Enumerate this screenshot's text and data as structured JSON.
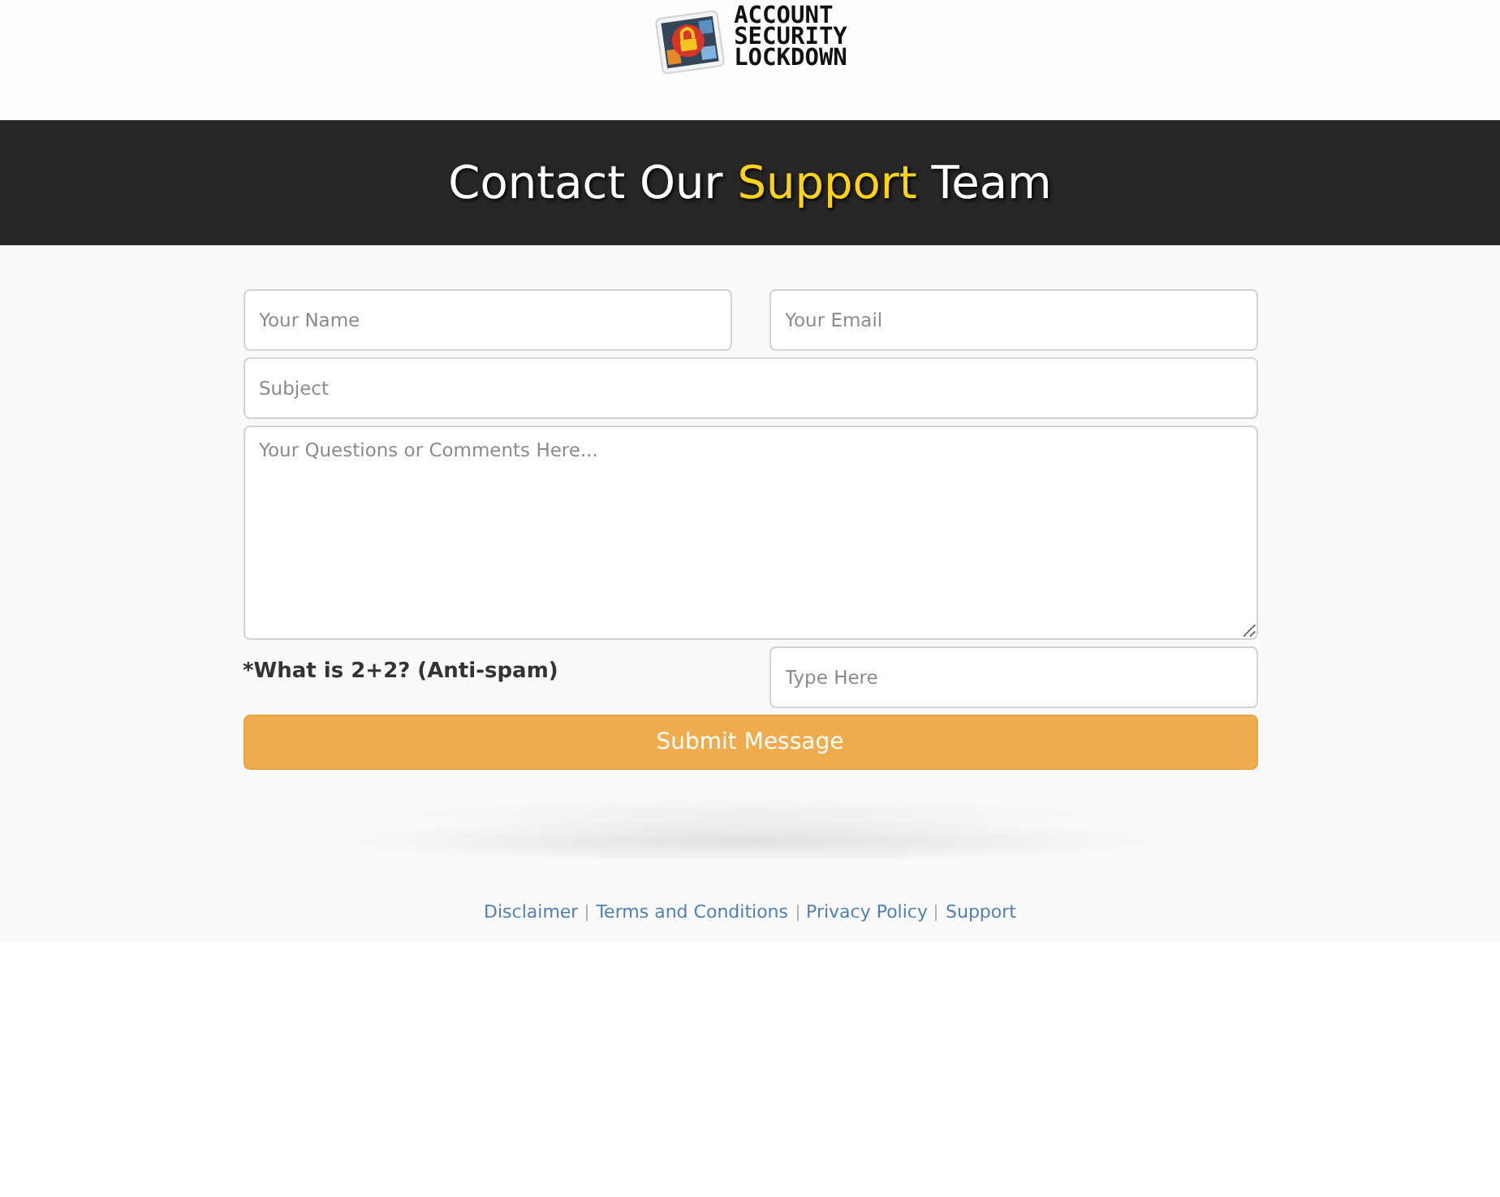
{
  "logo": {
    "lines": [
      "ACCOUNT",
      "SECURITY",
      "LOCKDOWN"
    ]
  },
  "header": {
    "title": "Contact Our **Support** Team"
  },
  "form": {
    "name": {
      "placeholder": "Your Name"
    },
    "email": {
      "placeholder": "Your Email"
    },
    "subject": {
      "placeholder": "Subject"
    },
    "message": {
      "placeholder": "Your Questions or Comments Here..."
    },
    "antispam": {
      "label": "*What is 2+2? (Anti-spam)",
      "placeholder": "Type Here"
    },
    "submit": "Submit Message"
  },
  "footer": {
    "links": [
      "Disclaimer",
      "Terms and Conditions",
      "Privacy Policy",
      "Support"
    ]
  }
}
